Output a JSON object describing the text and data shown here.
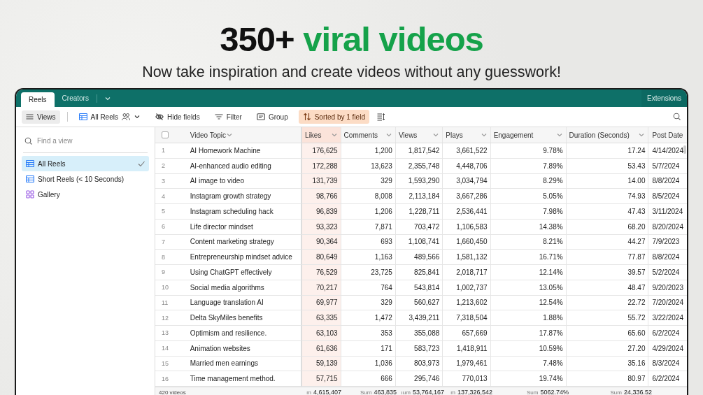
{
  "hero": {
    "title": [
      {
        "text": "350+",
        "highlight": false
      },
      {
        "text": "viral videos",
        "highlight": true
      }
    ],
    "subtitle": "Now take inspiration and create videos without any guesswork!"
  },
  "app": {
    "tabs": [
      {
        "label": "Reels",
        "selected": true
      },
      {
        "label": "Creators",
        "selected": false
      }
    ],
    "extensions": "Extensions",
    "toolbar": {
      "views": "Views",
      "view_name": "All Reels",
      "tools": [
        {
          "kind": "hide",
          "label": "Hide fields",
          "active": false
        },
        {
          "kind": "filter",
          "label": "Filter",
          "active": false
        },
        {
          "kind": "group",
          "label": "Group",
          "active": false
        },
        {
          "kind": "sort",
          "label": "Sorted by 1 field",
          "active": true
        }
      ]
    },
    "sidebar": {
      "search": {
        "placeholder": "Find a view"
      },
      "items": [
        {
          "label": "All Reels",
          "kind": "grid",
          "selected": true
        },
        {
          "label": "Short Reels (< 10 Seconds)",
          "kind": "grid",
          "selected": false
        },
        {
          "label": "Gallery",
          "kind": "gallery",
          "selected": false
        }
      ]
    },
    "table": {
      "select_all": {
        "checked": false
      },
      "columns": [
        {
          "label": "Video Topic",
          "sorted": false
        },
        {
          "label": "Likes",
          "sorted": true
        },
        {
          "label": "Comments",
          "sorted": false
        },
        {
          "label": "Views",
          "sorted": false
        },
        {
          "label": "Plays",
          "sorted": false
        },
        {
          "label": "Engagement",
          "sorted": false
        },
        {
          "label": "Duration (Seconds)",
          "sorted": false
        },
        {
          "label": "Post Date",
          "sorted": false
        }
      ],
      "rows": [
        {
          "number": "1",
          "cells": [
            "AI Homework Machine",
            "176,625",
            "1,200",
            "1,817,542",
            "3,661,522",
            "9.78%",
            "17.24",
            "4/14/2024"
          ]
        },
        {
          "number": "2",
          "cells": [
            "AI-enhanced audio editing",
            "172,288",
            "13,623",
            "2,355,748",
            "4,448,706",
            "7.89%",
            "53.43",
            "5/7/2024"
          ]
        },
        {
          "number": "3",
          "cells": [
            "AI image to video",
            "131,739",
            "329",
            "1,593,290",
            "3,034,794",
            "8.29%",
            "14.00",
            "8/8/2024"
          ]
        },
        {
          "number": "4",
          "cells": [
            "Instagram growth strategy",
            "98,766",
            "8,008",
            "2,113,184",
            "3,667,286",
            "5.05%",
            "74.93",
            "8/5/2024"
          ]
        },
        {
          "number": "5",
          "cells": [
            "Instagram scheduling hack",
            "96,839",
            "1,206",
            "1,228,711",
            "2,536,441",
            "7.98%",
            "47.43",
            "3/11/2024"
          ]
        },
        {
          "number": "6",
          "cells": [
            "Life director mindset",
            "93,323",
            "7,871",
            "703,472",
            "1,106,583",
            "14.38%",
            "68.20",
            "8/20/2024"
          ]
        },
        {
          "number": "7",
          "cells": [
            "Content marketing strategy",
            "90,364",
            "693",
            "1,108,741",
            "1,660,450",
            "8.21%",
            "44.27",
            "7/9/2023"
          ]
        },
        {
          "number": "8",
          "cells": [
            "Entrepreneurship mindset advice",
            "80,649",
            "1,163",
            "489,566",
            "1,581,132",
            "16.71%",
            "77.87",
            "8/8/2024"
          ]
        },
        {
          "number": "9",
          "cells": [
            "Using ChatGPT effectively",
            "76,529",
            "23,725",
            "825,841",
            "2,018,717",
            "12.14%",
            "39.57",
            "5/2/2024"
          ]
        },
        {
          "number": "10",
          "cells": [
            "Social media algorithms",
            "70,217",
            "764",
            "543,814",
            "1,002,737",
            "13.05%",
            "48.47",
            "9/20/2023"
          ]
        },
        {
          "number": "11",
          "cells": [
            "Language translation AI",
            "69,977",
            "329",
            "560,627",
            "1,213,602",
            "12.54%",
            "22.72",
            "7/20/2024"
          ]
        },
        {
          "number": "12",
          "cells": [
            "Delta SkyMiles benefits",
            "63,335",
            "1,472",
            "3,439,211",
            "7,318,504",
            "1.88%",
            "55.72",
            "3/22/2024"
          ]
        },
        {
          "number": "13",
          "cells": [
            "Optimism and resilience.",
            "63,103",
            "353",
            "355,088",
            "657,669",
            "17.87%",
            "65.60",
            "6/2/2024"
          ]
        },
        {
          "number": "14",
          "cells": [
            "Animation websites",
            "61,636",
            "171",
            "583,723",
            "1,418,911",
            "10.59%",
            "27.20",
            "4/29/2024"
          ]
        },
        {
          "number": "15",
          "cells": [
            "Married men earnings",
            "59,139",
            "1,036",
            "803,973",
            "1,979,461",
            "7.48%",
            "35.16",
            "8/3/2024"
          ]
        },
        {
          "number": "16",
          "cells": [
            "Time management method.",
            "57,715",
            "666",
            "295,746",
            "770,013",
            "19.74%",
            "80.97",
            "6/2/2024"
          ]
        }
      ],
      "footer": {
        "count": "420 videos",
        "sums": [
          {
            "label": "m",
            "value": "4,615,407"
          },
          {
            "label": "Sum",
            "value": "463,835"
          },
          {
            "label": "ıum",
            "value": "53,764,167"
          },
          {
            "label": "m",
            "value": "137,326,542"
          },
          {
            "label": "Sum",
            "value": "5062.74%"
          },
          {
            "label": "Sum",
            "value": "24,336.52"
          }
        ]
      }
    }
  }
}
